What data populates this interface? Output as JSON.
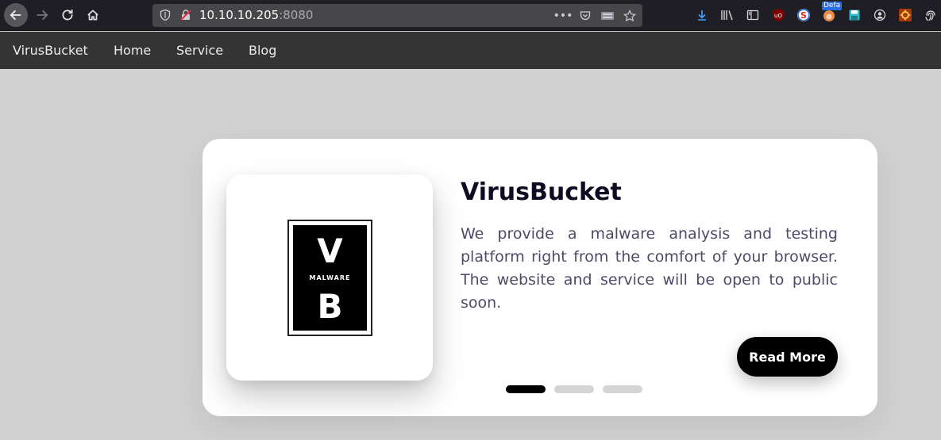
{
  "browser": {
    "url_host": "10.10.10.205",
    "url_port": ":8080",
    "addon_badge": "Defa"
  },
  "nav": {
    "brand": "VirusBucket",
    "items": [
      "Home",
      "Service",
      "Blog"
    ]
  },
  "card": {
    "title": "VirusBucket",
    "description": "We provide a malware analysis and testing platform right from the comfort of your browser. The website and service will be open to public soon.",
    "button_label": "Read More",
    "logo": {
      "top_letter": "V",
      "middle_text": "MALWARE",
      "bottom_letter": "B"
    },
    "slides": 3,
    "active_slide": 0
  },
  "colors": {
    "page_bg": "#d1d1d1",
    "navbar_bg": "#343434",
    "title": "#0d0c22",
    "text": "#4e4a67",
    "button_bg": "#000000"
  }
}
